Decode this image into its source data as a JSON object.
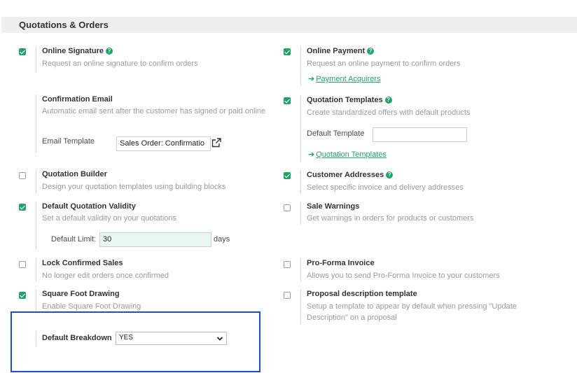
{
  "section": {
    "title": "Quotations & Orders"
  },
  "left": {
    "online_signature": {
      "title": "Online Signature",
      "help": "?",
      "desc": "Request an online signature to confirm orders",
      "checked": true
    },
    "confirmation_email": {
      "title": "Confirmation Email",
      "desc": "Automatic email sent after the customer has signed or paid online",
      "field_label": "Email Template",
      "field_value": "Sales Order: Confirmatio"
    },
    "quotation_builder": {
      "title": "Quotation Builder",
      "desc": "Design your quotation templates using building blocks",
      "checked": false
    },
    "default_quotation_validity": {
      "title": "Default Quotation Validity",
      "desc": "Set a default validity on your quotations",
      "checked": true,
      "field_label": "Default Limit:",
      "field_value": "30",
      "unit": "days"
    },
    "lock_confirmed_sales": {
      "title": "Lock Confirmed Sales",
      "desc": "No longer edit orders once confirmed",
      "checked": false
    },
    "square_foot_drawing": {
      "title": "Square Foot Drawing",
      "desc": "Enable Square Foot Drawing",
      "checked": true
    },
    "default_breakdown": {
      "title": "Default Breakdown",
      "value": "YES"
    }
  },
  "right": {
    "online_payment": {
      "title": "Online Payment",
      "help": "?",
      "desc": "Request an online payment to confirm orders",
      "checked": true,
      "link_arrow": "➔",
      "link_text": "Payment Acquirers"
    },
    "quotation_templates": {
      "title": "Quotation Templates",
      "help": "?",
      "desc": "Create standardized offers with default products",
      "checked": true,
      "field_label": "Default Template",
      "field_value": "",
      "link_arrow": "➔",
      "link_text": "Quotation Templates"
    },
    "customer_addresses": {
      "title": "Customer Addresses",
      "help": "?",
      "desc": "Select specific invoice and delivery addresses",
      "checked": true
    },
    "sale_warnings": {
      "title": "Sale Warnings",
      "desc": "Get warnings in orders for products or customers",
      "checked": false
    },
    "pro_forma_invoice": {
      "title": "Pro-Forma Invoice",
      "desc": "Allows you to send Pro-Forma Invoice to your customers",
      "checked": false
    },
    "proposal_description_template": {
      "title": "Proposal description template",
      "desc": "Setup a template to appear by default when pressing \"Update Description\" on a proposal",
      "checked": false
    }
  },
  "colors": {
    "accent": "#21a366",
    "highlight_border": "#1b4fc4",
    "header_bg": "#efefef",
    "limit_input_bg": "#e8f7f1"
  },
  "icons": {
    "external_link": "external-link-icon",
    "dropdown": "chevron-down-icon",
    "help": "help-icon"
  }
}
